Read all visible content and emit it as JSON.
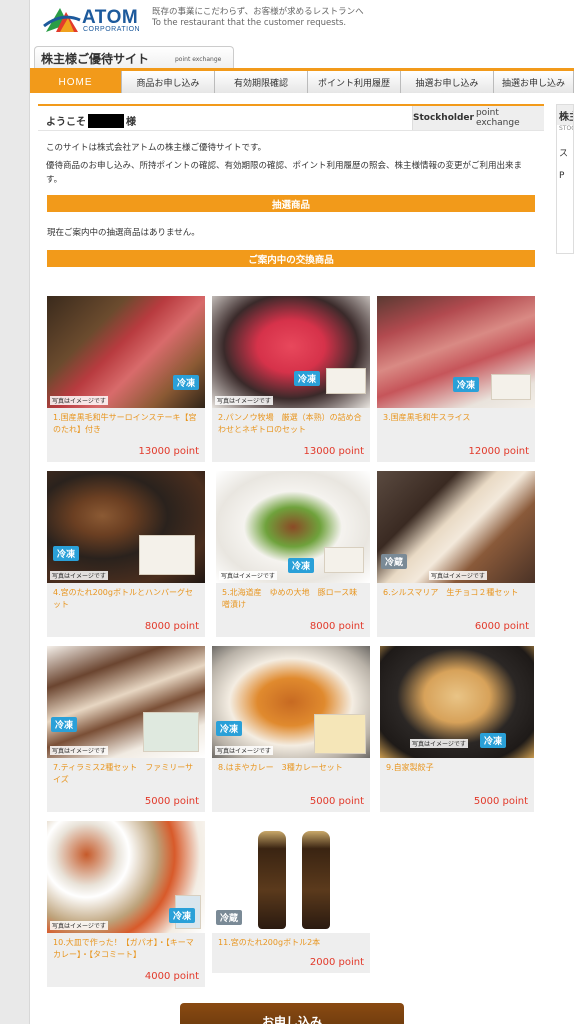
{
  "header": {
    "logo_text": "ATOM",
    "logo_sub": "CORPORATION",
    "tagline_jp": "既存の事業にこだわらず、お客様が求めるレストランへ",
    "tagline_en": "To the restaurant that the customer requests."
  },
  "site": {
    "title": "株主様ご優待サイト",
    "subtitle": "point exchange"
  },
  "nav": {
    "items": [
      "HOME",
      "商品お申し込み",
      "有効期限確認",
      "ポイント利用履歴",
      "抽選お申し込み",
      "抽選お申し込み"
    ]
  },
  "sidebar_right": {
    "header": "株主",
    "sub": "STOC",
    "line1": "ス",
    "line2": "P"
  },
  "welcome": {
    "prefix": "ようこそ",
    "suffix": "様",
    "stockholder_bold": "Stockholder",
    "stockholder_rest": "point exchange"
  },
  "intro": {
    "p1": "このサイトは株式会社アトムの株主様ご優待サイトです。",
    "p2": "優待商品のお申し込み、所持ポイントの確認、有効期限の確認、ポイント利用履歴の照会、株主様情報の変更がご利用出来ます。"
  },
  "lottery": {
    "heading": "抽選商品",
    "message": "現在ご案内中の抽選商品はありません。"
  },
  "exchange": {
    "heading": "ご案内中の交換商品",
    "note": "写真はイメージです",
    "products": [
      {
        "name": "1.国産黒毛和牛サーロインステーキ【宮のたれ】付き",
        "points": "13000 point",
        "badge": "冷凍",
        "badge_type": "frozen"
      },
      {
        "name": "2.パンノウ牧場　厳選（本熟）の詰め合わせとネギトロのセット",
        "points": "13000 point",
        "badge": "冷凍",
        "badge_type": "frozen"
      },
      {
        "name": "3.国産黒毛和牛スライス",
        "points": "12000 point",
        "badge": "冷凍",
        "badge_type": "frozen"
      },
      {
        "name": "4.宮のたれ200gボトルとハンバーグセット",
        "points": "8000 point",
        "badge": "冷凍",
        "badge_type": "frozen"
      },
      {
        "name": "5.北海道産　ゆめの大地　豚ロース味噌漬け",
        "points": "8000 point",
        "badge": "冷凍",
        "badge_type": "frozen"
      },
      {
        "name": "6.シルスマリア　生チョコ２種セット",
        "points": "6000 point",
        "badge": "冷蔵",
        "badge_type": "chilled"
      },
      {
        "name": "7.ティラミス2種セット　ファミリーサイズ",
        "points": "5000 point",
        "badge": "冷凍",
        "badge_type": "frozen"
      },
      {
        "name": "8.はまやカレー　3種カレーセット",
        "points": "5000 point",
        "badge": "冷凍",
        "badge_type": "frozen"
      },
      {
        "name": "9.自家製餃子",
        "points": "5000 point",
        "badge": "冷凍",
        "badge_type": "frozen"
      },
      {
        "name": "10.大皿で作った！【ガパオ】・【キーマカレー】・【タコミート】",
        "points": "4000 point",
        "badge": "冷凍",
        "badge_type": "frozen"
      },
      {
        "name": "11.宮のたれ200gボトル2本",
        "points": "2000 point",
        "badge": "冷蔵",
        "badge_type": "chilled"
      }
    ]
  },
  "apply_button": "お申し込み",
  "colors": {
    "accent": "#f29a1a",
    "points": "#e2392a",
    "product_name": "#e8951e",
    "frozen": "#2aa0d8",
    "chilled": "#7a8a96",
    "button": "#7a4210"
  }
}
